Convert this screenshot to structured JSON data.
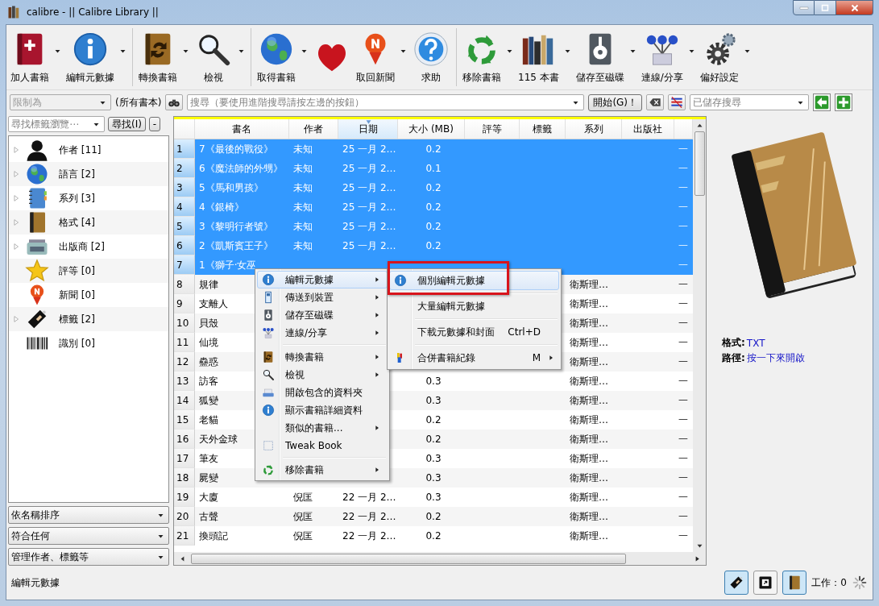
{
  "window": {
    "title": "calibre - || Calibre Library ||"
  },
  "toolbar": {
    "groups": [
      [
        {
          "label": "加人書籍",
          "dropdown": true
        },
        {
          "label": "編輯元數據",
          "dropdown": true
        }
      ],
      [
        {
          "label": "轉換書籍",
          "dropdown": true
        },
        {
          "label": "檢視",
          "dropdown": true
        }
      ],
      [
        {
          "label": "取得書籍",
          "dropdown": true
        },
        {
          "dropdown": false
        },
        {
          "label": "取回新聞",
          "dropdown": true
        },
        {
          "label": "求助",
          "dropdown": false
        }
      ],
      [
        {
          "label": "移除書籍",
          "dropdown": true
        },
        {
          "label": "115 本書",
          "dropdown": true
        },
        {
          "label": "儲存至磁碟",
          "dropdown": true
        },
        {
          "label": "連線/分享",
          "dropdown": true
        },
        {
          "label": "偏好設定",
          "dropdown": true
        }
      ]
    ]
  },
  "search_bar": {
    "restrict": {
      "placeholder": "限制為",
      "disabled": true
    },
    "scope_label": "(所有書本)",
    "search": {
      "placeholder": "搜尋（要使用進階搜尋請按左邊的按鈕）"
    },
    "go_button": "開始(G)！",
    "saved_search": {
      "placeholder": "已儲存搜尋"
    }
  },
  "tag_browser": {
    "find": {
      "placeholder": "尋找標籤瀏覽⋯"
    },
    "find_button": "尋找(I)",
    "collapse_button": "-",
    "items": [
      {
        "label": "作者 [11]",
        "expandable": true
      },
      {
        "label": "語言 [2]",
        "expandable": true
      },
      {
        "label": "系列 [3]",
        "expandable": true
      },
      {
        "label": "格式 [4]",
        "expandable": true
      },
      {
        "label": "出版商 [2]",
        "expandable": true
      },
      {
        "label": "評等 [0]",
        "expandable": false
      },
      {
        "label": "新聞 [0]",
        "expandable": false
      },
      {
        "label": "標籤 [2]",
        "expandable": true
      },
      {
        "label": "識別 [0]",
        "expandable": false
      }
    ],
    "sort_by": "依名稱排序",
    "match": "符合任何",
    "manage": "管理作者、標籤等"
  },
  "book_table": {
    "columns": [
      {
        "label": "書名",
        "sorted": false
      },
      {
        "label": "作者",
        "sorted": false
      },
      {
        "label": "日期",
        "sorted": true
      },
      {
        "label": "大小 (MB)",
        "sorted": false
      },
      {
        "label": "評等",
        "sorted": false
      },
      {
        "label": "標籤",
        "sorted": false
      },
      {
        "label": "系列",
        "sorted": false
      },
      {
        "label": "出版社",
        "sorted": false
      }
    ],
    "rows": [
      {
        "num": "1",
        "title": "7《最後的戰役》",
        "author": "未知",
        "date": "25 一月 2…",
        "size": "0.2",
        "column_10": "一",
        "selected": true
      },
      {
        "num": "2",
        "title": "6《魔法師的外甥》",
        "author": "未知",
        "date": "25 一月 2…",
        "size": "0.1",
        "column_10": "一",
        "selected": true
      },
      {
        "num": "3",
        "title": "5《馬和男孩》",
        "author": "未知",
        "date": "25 一月 2…",
        "size": "0.2",
        "column_10": "一",
        "selected": true
      },
      {
        "num": "4",
        "title": "4《銀椅》",
        "author": "未知",
        "date": "25 一月 2…",
        "size": "0.2",
        "column_10": "一",
        "selected": true
      },
      {
        "num": "5",
        "title": "3《黎明行者號》",
        "author": "未知",
        "date": "25 一月 2…",
        "size": "0.2",
        "column_10": "一",
        "selected": true
      },
      {
        "num": "6",
        "title": "2《凱斯賓王子》",
        "author": "未知",
        "date": "25 一月 2…",
        "size": "0.2",
        "column_10": "一",
        "selected": true
      },
      {
        "num": "7",
        "title": "1《獅子·女巫",
        "column_10": "一",
        "selected": true
      },
      {
        "num": "8",
        "title": "規律",
        "series": "衛斯理…",
        "column_10": "一",
        "selected": false
      },
      {
        "num": "9",
        "title": "支離人",
        "series": "衛斯理…",
        "column_10": "一",
        "selected": false
      },
      {
        "num": "10",
        "title": "貝殼",
        "series": "衛斯理…",
        "column_10": "一",
        "selected": false
      },
      {
        "num": "11",
        "title": "仙境",
        "series": "衛斯理…",
        "column_10": "一",
        "selected": false
      },
      {
        "num": "12",
        "title": "蠱惑",
        "series": "衛斯理…",
        "column_10": "一",
        "selected": false
      },
      {
        "num": "13",
        "title": "訪客",
        "size": "0.3",
        "series": "衛斯理…",
        "column_10": "一",
        "selected": false
      },
      {
        "num": "14",
        "title": "狐變",
        "size": "0.3",
        "series": "衛斯理…",
        "column_10": "一",
        "selected": false
      },
      {
        "num": "15",
        "title": "老貓",
        "size": "0.2",
        "series": "衛斯理…",
        "column_10": "一",
        "selected": false
      },
      {
        "num": "16",
        "title": "天外金球",
        "size": "0.2",
        "series": "衛斯理…",
        "column_10": "一",
        "selected": false
      },
      {
        "num": "17",
        "title": "筆友",
        "size": "0.3",
        "series": "衛斯理…",
        "column_10": "一",
        "selected": false
      },
      {
        "num": "18",
        "title": "屍變",
        "size": "0.3",
        "series": "衛斯理…",
        "column_10": "一",
        "selected": false
      },
      {
        "num": "19",
        "title": "大廈",
        "author": "倪匡",
        "date": "22 一月 2…",
        "size": "0.3",
        "series": "衛斯理…",
        "column_10": "一",
        "selected": false
      },
      {
        "num": "20",
        "title": "古聲",
        "author": "倪匡",
        "date": "22 一月 2…",
        "size": "0.2",
        "series": "衛斯理…",
        "column_10": "一",
        "selected": false
      },
      {
        "num": "21",
        "title": "換頭記",
        "author": "倪匡",
        "date": "22 一月 2…",
        "size": "0.2",
        "series": "衛斯理…",
        "column_10": "一",
        "selected": false
      }
    ]
  },
  "context_menu": {
    "items": [
      {
        "kind": "item",
        "label": "編輯元數據",
        "submenu": true,
        "selected": true
      },
      {
        "kind": "item",
        "label": "傳送到裝置",
        "submenu": true,
        "selected": false
      },
      {
        "kind": "item",
        "label": "儲存至磁碟",
        "submenu": true,
        "selected": false
      },
      {
        "kind": "item",
        "label": "連線/分享",
        "submenu": true,
        "selected": false
      },
      {
        "kind": "separator"
      },
      {
        "kind": "item",
        "label": "轉換書籍",
        "submenu": true,
        "selected": false
      },
      {
        "kind": "item",
        "label": "檢視",
        "submenu": true,
        "selected": false
      },
      {
        "kind": "item",
        "label": "開啟包含的資料夾",
        "submenu": false,
        "selected": false
      },
      {
        "kind": "item",
        "label": "顯示書籍詳細資料",
        "submenu": false,
        "selected": false
      },
      {
        "kind": "item",
        "label": "類似的書籍...",
        "submenu": true,
        "selected": false
      },
      {
        "kind": "item",
        "label": "Tweak Book",
        "submenu": false,
        "selected": false
      },
      {
        "kind": "separator"
      },
      {
        "kind": "item",
        "label": "移除書籍",
        "submenu": true,
        "selected": false
      }
    ],
    "submenu": {
      "items": [
        {
          "kind": "item",
          "label": "個別編輯元數據",
          "submenu": false,
          "selected": true,
          "callout": true
        },
        {
          "kind": "separator"
        },
        {
          "kind": "item",
          "label": "大量編輯元數據",
          "submenu": false,
          "selected": false,
          "callout": false
        },
        {
          "kind": "separator"
        },
        {
          "kind": "item",
          "label": "下載元數據和封面",
          "shortcut": "Ctrl+D",
          "submenu": false,
          "selected": false,
          "callout": false
        },
        {
          "kind": "separator"
        },
        {
          "kind": "item",
          "label": "合併書籍紀錄",
          "shortcut": "M",
          "submenu": true,
          "selected": false,
          "callout": false
        }
      ]
    }
  },
  "book_details": {
    "fields": [
      {
        "label": "格式:",
        "value": "TXT"
      },
      {
        "label": "路徑:",
        "value": "按一下來開啟"
      }
    ]
  },
  "status_bar": {
    "message": "編輯元數據",
    "toggles": [
      {
        "pressed": true
      },
      {
        "pressed": false
      },
      {
        "pressed": true
      }
    ],
    "jobs_label": "工作：0"
  }
}
